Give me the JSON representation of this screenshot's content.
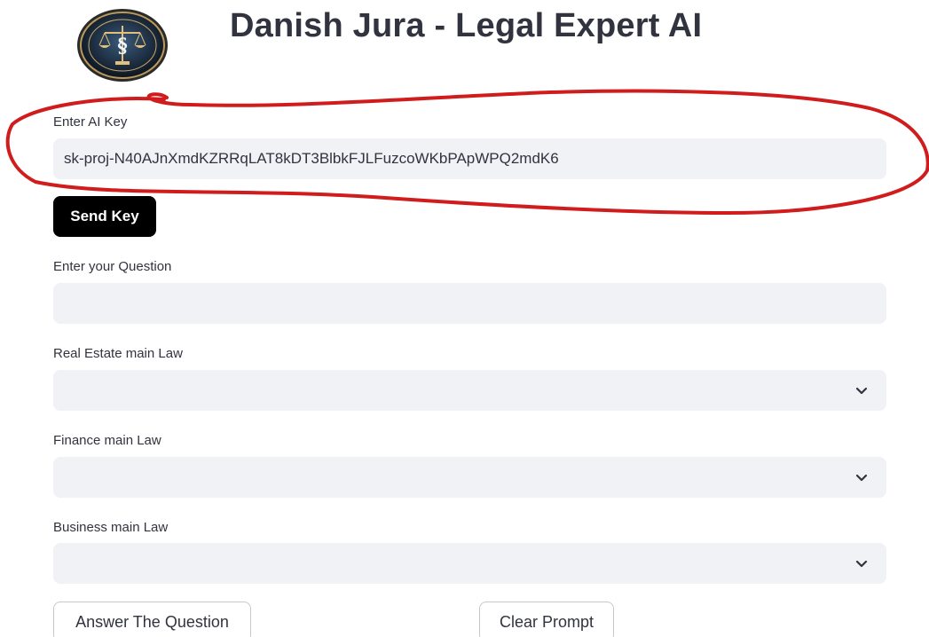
{
  "header": {
    "title": "Danish Jura - Legal Expert AI",
    "logo_icon": "scales-of-justice-seal-icon"
  },
  "ai_key": {
    "label": "Enter AI Key",
    "value": "sk-proj-N40AJnXmdKZRRqLAT8kDT3BlbkFJLFuzcoWKbPApWPQ2mdK6"
  },
  "send_key": {
    "label": "Send Key"
  },
  "question": {
    "label": "Enter your Question",
    "value": ""
  },
  "selects": {
    "real_estate": {
      "label": "Real Estate main Law",
      "value": ""
    },
    "finance": {
      "label": "Finance main Law",
      "value": ""
    },
    "business": {
      "label": "Business main Law",
      "value": ""
    }
  },
  "actions": {
    "answer_label": "Answer The Question",
    "clear_label": "Clear Prompt"
  },
  "colors": {
    "input_background": "#f0f2f6",
    "text": "#31333f",
    "primary_button": "#000000",
    "annotation_circle": "#d01c1c"
  }
}
